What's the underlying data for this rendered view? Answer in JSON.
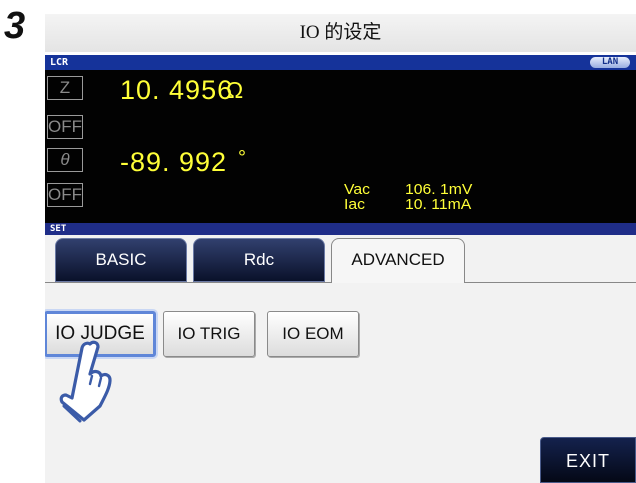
{
  "step_number": "3",
  "title": "IO 的设定",
  "lcr_section": {
    "label": "LCR",
    "lan_badge": "LAN",
    "param1": {
      "symbol": "Z",
      "value": "10. 4956",
      "unit": "Ω"
    },
    "param1_off": "OFF",
    "param2": {
      "symbol": "θ",
      "value": "-89. 992",
      "unit": "°"
    },
    "param2_off": "OFF",
    "monitor": [
      {
        "label": "Vac",
        "value": "106. 1mV"
      },
      {
        "label": "Iac",
        "value": "10. 11mA"
      }
    ]
  },
  "set_section": {
    "label": "SET",
    "tabs": [
      {
        "label": "BASIC",
        "active": false
      },
      {
        "label": "Rdc",
        "active": false
      },
      {
        "label": "ADVANCED",
        "active": true
      }
    ],
    "options": [
      {
        "label": "IO JUDGE",
        "selected": true
      },
      {
        "label": "IO TRIG",
        "selected": false
      },
      {
        "label": "IO EOM",
        "selected": false
      }
    ],
    "exit_label": "EXIT"
  },
  "colors": {
    "measurement_text": "#ffff38",
    "header_bar": "#15339a",
    "tab_inactive": "#0a112a",
    "selection_outline": "#5f86d8"
  },
  "icons": [
    "pointing-hand-icon"
  ]
}
